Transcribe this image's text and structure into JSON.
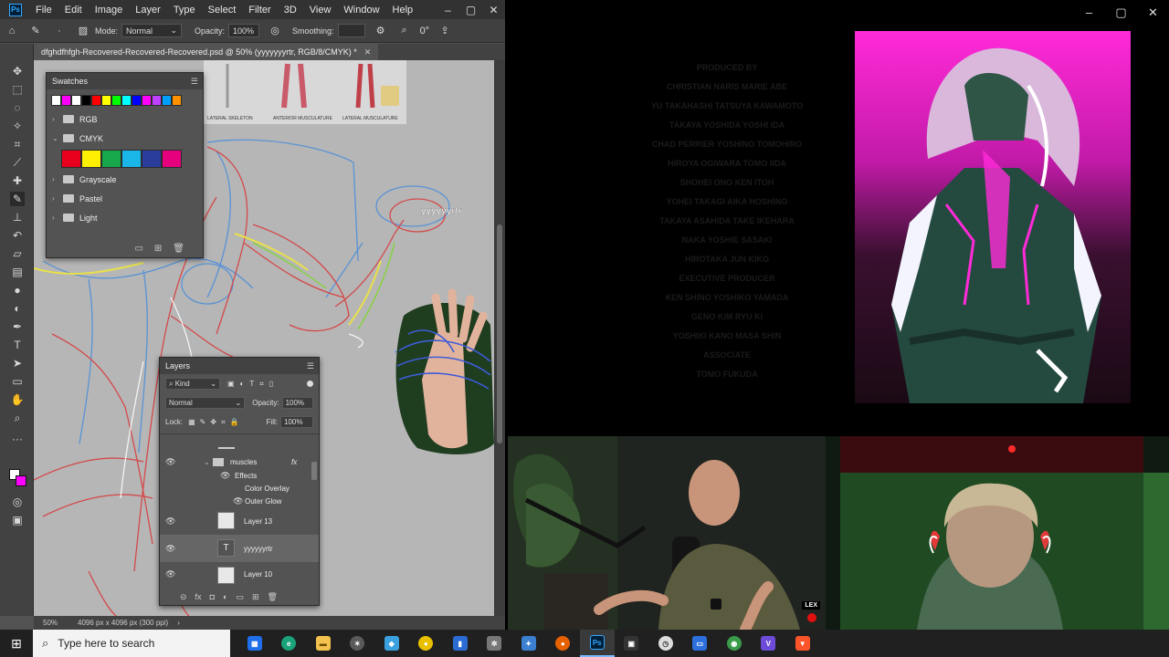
{
  "photoshop": {
    "logo": "Ps",
    "menu": [
      "File",
      "Edit",
      "Image",
      "Layer",
      "Type",
      "Select",
      "Filter",
      "3D",
      "View",
      "Window",
      "Help"
    ],
    "options": {
      "mode_label": "Mode:",
      "mode_value": "Normal",
      "opacity_label": "Opacity:",
      "opacity_value": "100%",
      "smoothing_label": "Smoothing:",
      "angle_value": "0°"
    },
    "document_tab": "dfghdfhfgh-Recovered-Recovered-Recovered.psd @ 50% (yyyyyyyrtr, RGB/8/CMYK) *",
    "canvas": {
      "reference_labels": [
        "LATERAL SKELETON",
        "ANTERIOR MUSCULATURE",
        "LATERAL MUSCULATURE"
      ],
      "text_layer_label": "yyyyyyrtr"
    },
    "status": {
      "zoom": "50%",
      "doc_size": "4096 px x 4096 px (300 ppi)"
    },
    "swatches": {
      "title": "Swatches",
      "recent_colors": [
        "#ffffff",
        "#ff00ff",
        "#ffffff",
        "#000000",
        "#ff0000",
        "#ffff00",
        "#00ff00",
        "#00ffff",
        "#0000ff",
        "#ff00ff",
        "#c040ff",
        "#00a0ff",
        "#ff9000"
      ],
      "groups": [
        {
          "label": "RGB",
          "expanded": false
        },
        {
          "label": "CMYK",
          "expanded": true
        },
        {
          "label": "Grayscale",
          "expanded": false
        },
        {
          "label": "Pastel",
          "expanded": false
        },
        {
          "label": "Light",
          "expanded": false
        }
      ],
      "cmyk_colors": [
        "#e8001c",
        "#ffef00",
        "#17a84b",
        "#1ab6e8",
        "#2b3d9c",
        "#e6007e"
      ]
    },
    "layers": {
      "title": "Layers",
      "filter_kind": "Kind",
      "blend_mode": "Normal",
      "opacity_label": "Opacity:",
      "opacity_value": "100%",
      "lock_label": "Lock:",
      "fill_label": "Fill:",
      "fill_value": "100%",
      "rows": [
        {
          "name": "muscles",
          "type": "group",
          "fx": "fx"
        },
        {
          "name": "Effects",
          "type": "effects"
        },
        {
          "name": "Color Overlay",
          "type": "effect"
        },
        {
          "name": "Outer Glow",
          "type": "effect"
        },
        {
          "name": "Layer 13",
          "type": "pixel"
        },
        {
          "name": "yyyyyyrtr",
          "type": "text",
          "thumb": "T"
        },
        {
          "name": "Layer 10",
          "type": "pixel"
        }
      ]
    }
  },
  "video_top": {
    "credits_lines": [
      "PRODUCED BY",
      "CHRISTIAN NARIS    MARIE ABE",
      "YU TAKAHASHI    TATSUYA KAWAMOTO",
      "TAKAYA YOSHIDA    YOSHI IDA",
      "CHAD PERRIER    YOSHINO TOMOHIRO",
      "HIROYA OGIWARA    TOMO IIDA",
      "SHOHEI ONO    KEN ITOH",
      "YOHEI TAKAGI    AIKA HOSHINO",
      "TAKAYA ASAHIDA    TAKE IKEHARA",
      "NAKA    YOSHIE SASAKI",
      "HIROTAKA    JUN KIKO",
      "EXECUTIVE PRODUCER",
      "KEN SHINO    YOSHIKO YAMADA",
      "GENO KIM    RYU KI",
      "YOSHIKI KANO    MASA SHIN",
      "ASSOCIATE",
      "TOMO FUKUDA"
    ]
  },
  "cam_left": {
    "watermark": "LEX"
  },
  "taskbar": {
    "search_placeholder": "Type here to search",
    "apps": [
      {
        "name": "task-view",
        "color": "#1f6feb",
        "glyph": "▦"
      },
      {
        "name": "edge",
        "color": "#1aa37a",
        "glyph": "e"
      },
      {
        "name": "file-explorer",
        "color": "#f2c14e",
        "glyph": "▬"
      },
      {
        "name": "app-badge",
        "color": "#5a5a5a",
        "glyph": "✶"
      },
      {
        "name": "app-blue",
        "color": "#3aa0e0",
        "glyph": "◆"
      },
      {
        "name": "app-tips",
        "color": "#e8c000",
        "glyph": "●"
      },
      {
        "name": "app-doc",
        "color": "#2b6cd4",
        "glyph": "▮"
      },
      {
        "name": "app-gear",
        "color": "#777777",
        "glyph": "✲"
      },
      {
        "name": "app-star",
        "color": "#3c80d0",
        "glyph": "✦"
      },
      {
        "name": "firefox",
        "color": "#e66000",
        "glyph": "●"
      },
      {
        "name": "photoshop",
        "color": "#001e36",
        "glyph": "Ps"
      },
      {
        "name": "app-dark",
        "color": "#333333",
        "glyph": "▣"
      },
      {
        "name": "app-clock",
        "color": "#dddddd",
        "glyph": "◷"
      },
      {
        "name": "app-window",
        "color": "#2d6fdc",
        "glyph": "▭"
      },
      {
        "name": "chrome",
        "color": "#3a9b4a",
        "glyph": "◉"
      },
      {
        "name": "app-v",
        "color": "#6c4bd8",
        "glyph": "V"
      },
      {
        "name": "brave",
        "color": "#fb542b",
        "glyph": "▼"
      }
    ]
  }
}
